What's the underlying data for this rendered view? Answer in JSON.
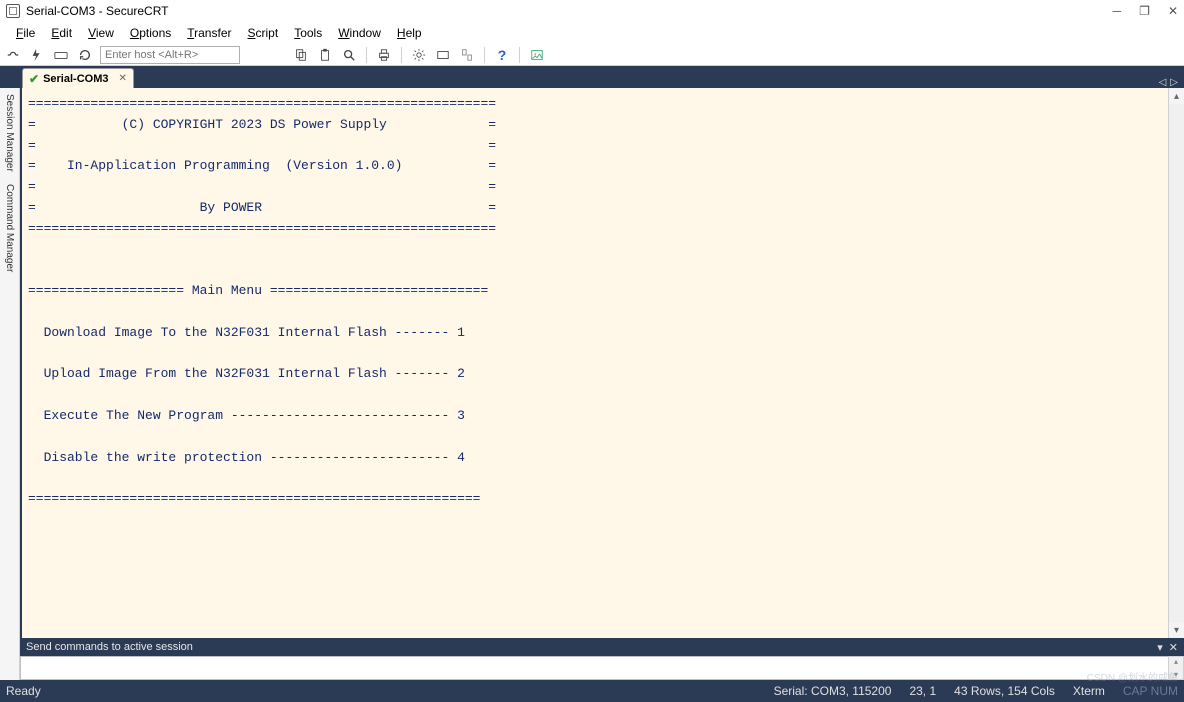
{
  "window": {
    "title": "Serial-COM3 - SecureCRT"
  },
  "menu": {
    "items": [
      "File",
      "Edit",
      "View",
      "Options",
      "Transfer",
      "Script",
      "Tools",
      "Window",
      "Help"
    ]
  },
  "toolbar": {
    "host_placeholder": "Enter host <Alt+R>"
  },
  "tab": {
    "name": "Serial-COM3"
  },
  "side_tabs": {
    "session_manager": "Session Manager",
    "command_manager": "Command Manager"
  },
  "terminal": {
    "lines": [
      "============================================================",
      "=           (C) COPYRIGHT 2023 DS Power Supply             =",
      "=                                                          =",
      "=    In-Application Programming  (Version 1.0.0)           =",
      "=                                                          =",
      "=                     By POWER                             =",
      "============================================================",
      "",
      "",
      "==================== Main Menu ============================",
      "",
      "  Download Image To the N32F031 Internal Flash ------- 1",
      "",
      "  Upload Image From the N32F031 Internal Flash ------- 2",
      "",
      "  Execute The New Program ---------------------------- 3",
      "",
      "  Disable the write protection ----------------------- 4",
      "",
      "=========================================================="
    ]
  },
  "command_bar": {
    "label": "Send commands to active session"
  },
  "status": {
    "ready": "Ready",
    "port": "Serial: COM3, 115200",
    "cursor": "23,  1",
    "size": "43 Rows, 154 Cols",
    "emu": "Xterm",
    "caps": "CAP NUM"
  },
  "watermark": "CSDN @划水的咸鱼"
}
